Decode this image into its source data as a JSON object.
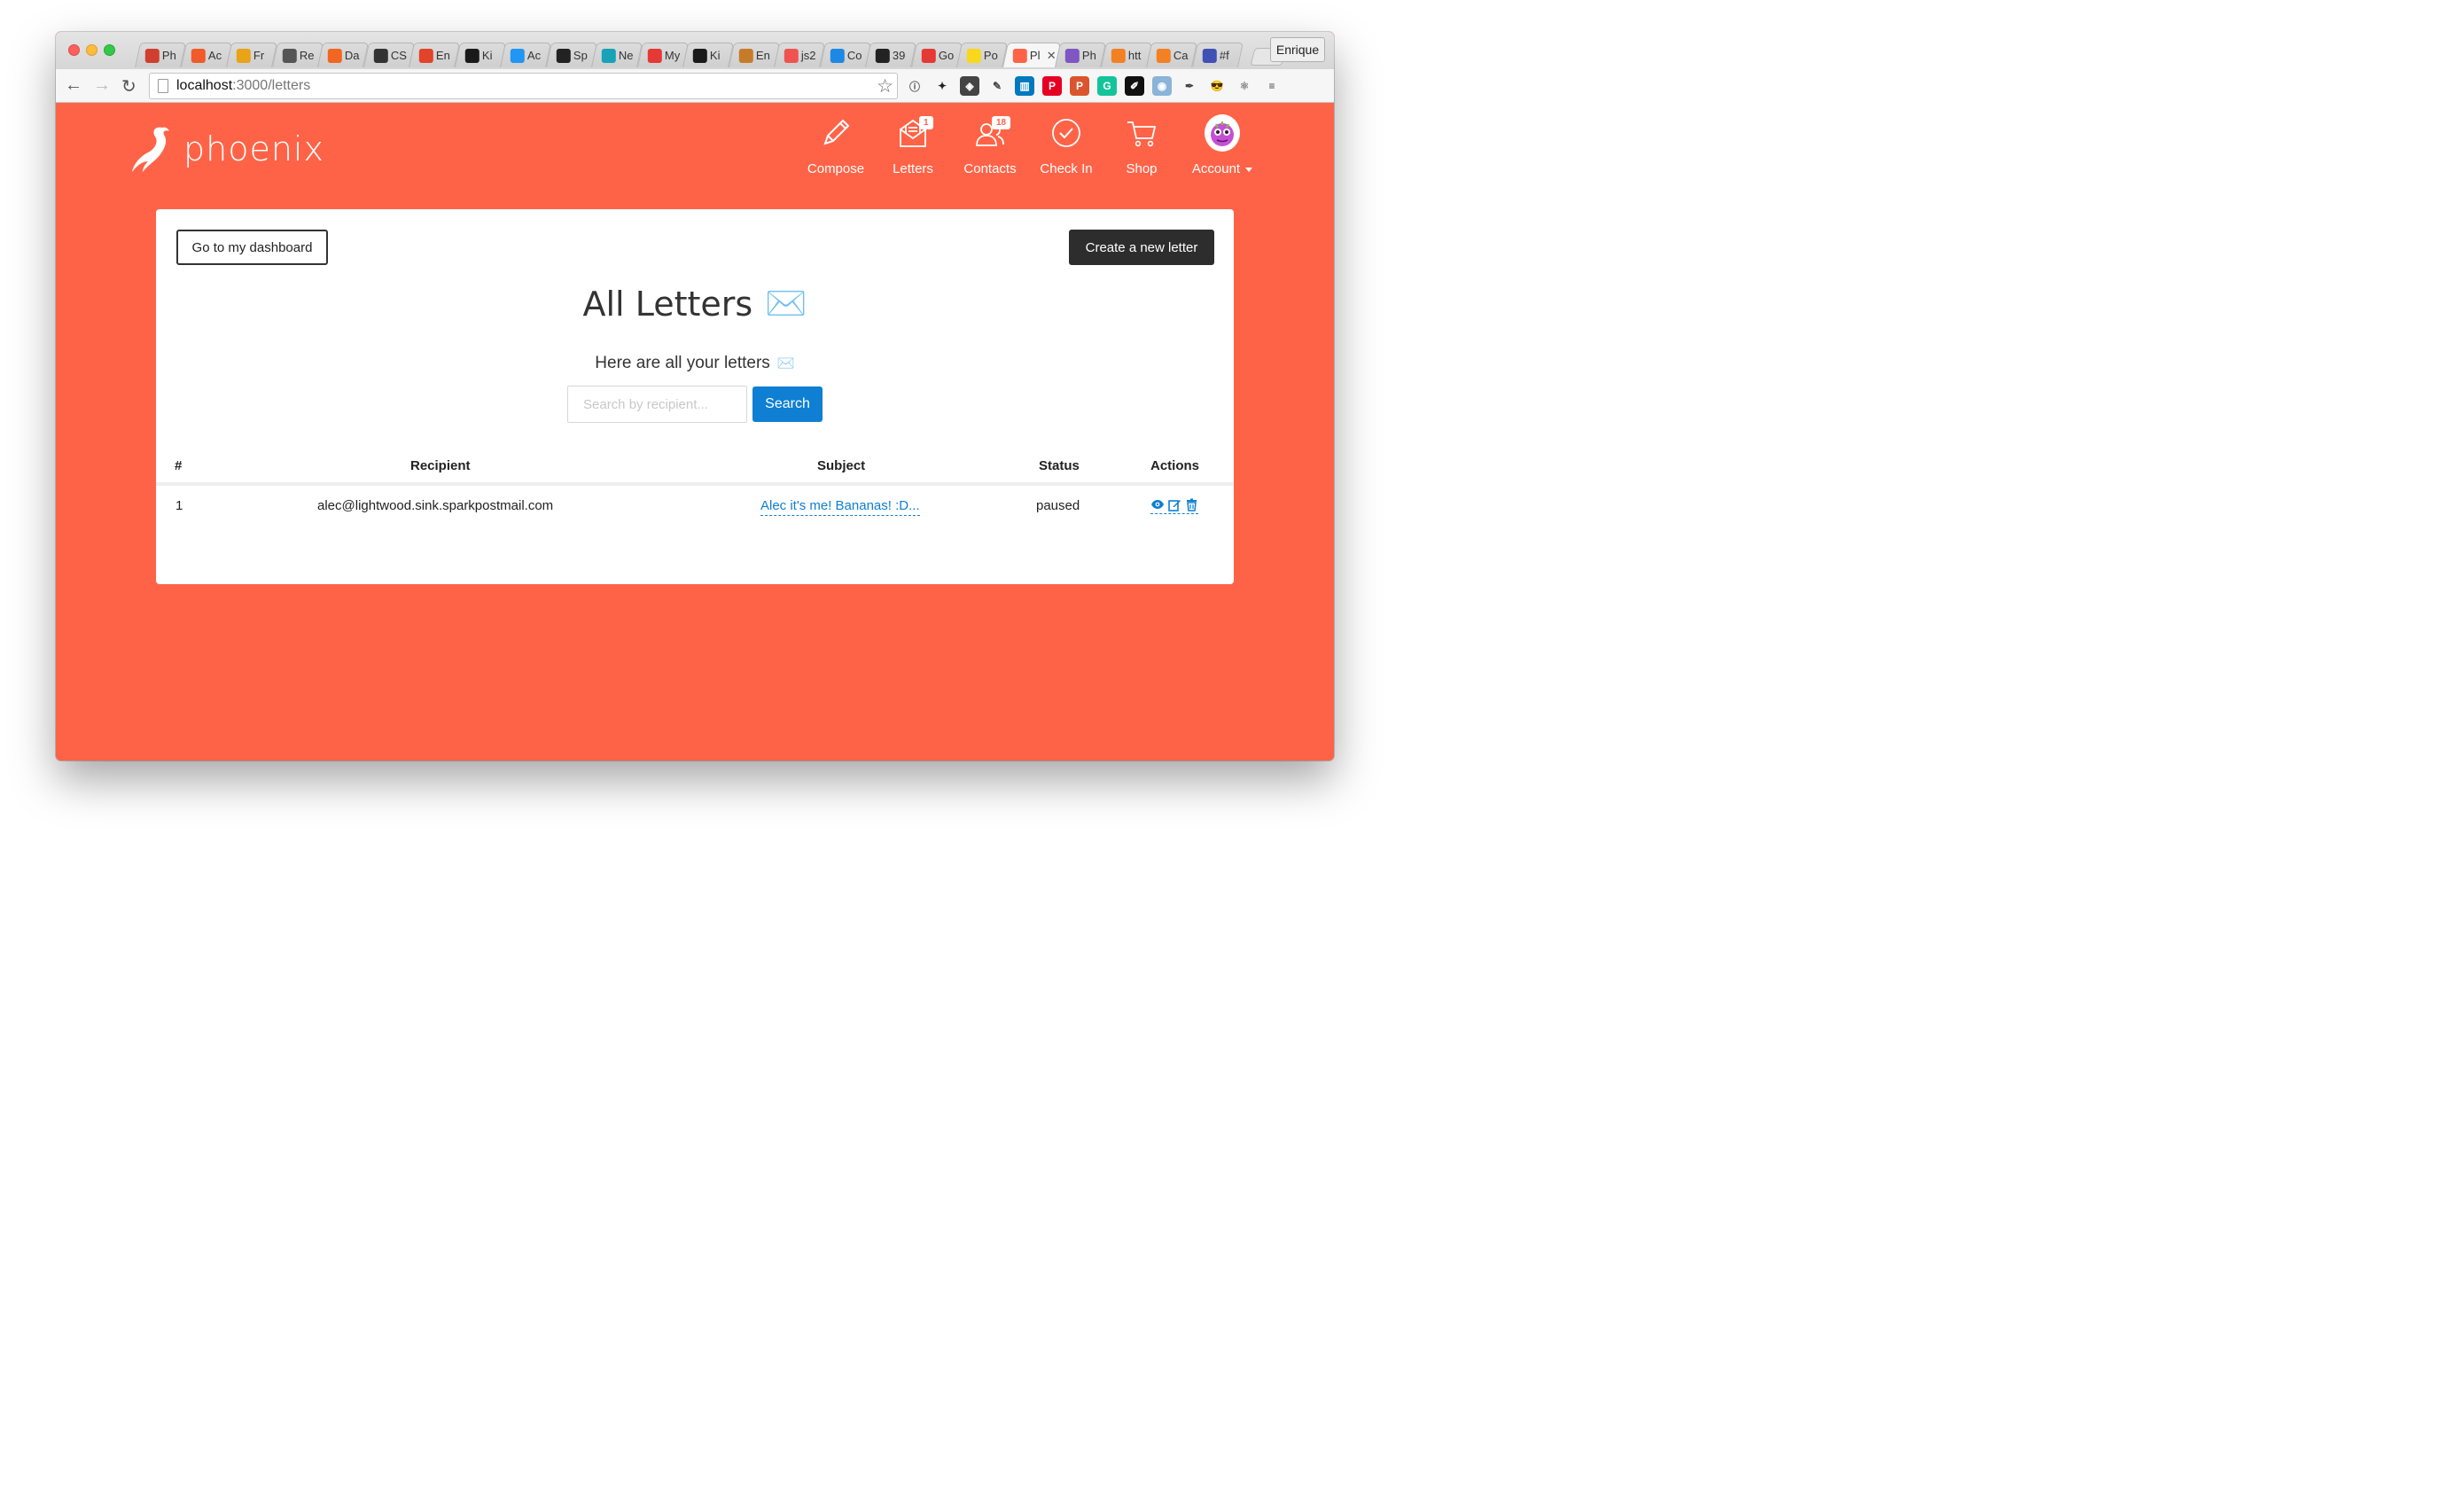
{
  "browser": {
    "tabs": [
      {
        "label": "Ph",
        "icon": "trello-icon",
        "color": "#d03f2e"
      },
      {
        "label": "Ac",
        "icon": "orange-app-icon",
        "color": "#f15a29"
      },
      {
        "label": "Fr",
        "icon": "paper-plane-icon",
        "color": "#e8a317"
      },
      {
        "label": "Re",
        "icon": "magnifier-icon",
        "color": "#555555"
      },
      {
        "label": "Da",
        "icon": "flame-icon",
        "color": "#f26522"
      },
      {
        "label": "CS",
        "icon": "mail-icon",
        "color": "#333333"
      },
      {
        "label": "En",
        "icon": "gitlab-icon",
        "color": "#e24329"
      },
      {
        "label": "Ki",
        "icon": "tk-icon",
        "color": "#1a1a1a"
      },
      {
        "label": "Ac",
        "icon": "diamond-icon",
        "color": "#2196f3"
      },
      {
        "label": "Sp",
        "icon": "github-icon",
        "color": "#222222"
      },
      {
        "label": "Ne",
        "icon": "cycle-icon",
        "color": "#17a2b8"
      },
      {
        "label": "My",
        "icon": "facebook-icon",
        "color": "#e53935"
      },
      {
        "label": "Ki",
        "icon": "tk-icon",
        "color": "#1a1a1a"
      },
      {
        "label": "En",
        "icon": "thumbs-up-icon",
        "color": "#c77b2a"
      },
      {
        "label": "js2",
        "icon": "arrows-icon",
        "color": "#ef5350"
      },
      {
        "label": "Co",
        "icon": "chart-icon",
        "color": "#1e88e5"
      },
      {
        "label": "39",
        "icon": "bold-b-icon",
        "color": "#222222"
      },
      {
        "label": "Go",
        "icon": "triangle-icon",
        "color": "#e53935"
      },
      {
        "label": "Po",
        "icon": "p-icon",
        "color": "#f9d71c"
      },
      {
        "label": "Pl",
        "icon": "phoenix-tab-icon",
        "color": "#ff6347",
        "active": true
      },
      {
        "label": "Ph",
        "icon": "image-icon",
        "color": "#7e57c2"
      },
      {
        "label": "htt",
        "icon": "stack-icon",
        "color": "#f48024"
      },
      {
        "label": "Ca",
        "icon": "stack-icon",
        "color": "#f48024"
      },
      {
        "label": "#f",
        "icon": "hex-icon",
        "color": "#3f51b5"
      }
    ],
    "close_glyph": "✕",
    "profile_name": "Enrique",
    "url_host": "localhost",
    "url_path": ":3000/letters",
    "extensions": [
      {
        "name": "info-icon",
        "glyph": "ⓘ",
        "color": "#555555",
        "bg": "transparent"
      },
      {
        "name": "pin-icon",
        "glyph": "✦",
        "color": "#222222",
        "bg": "transparent"
      },
      {
        "name": "pocket-icon",
        "glyph": "◈",
        "color": "#ffffff",
        "bg": "#444444"
      },
      {
        "name": "evernote-icon",
        "glyph": "✎",
        "color": "#444444",
        "bg": "transparent"
      },
      {
        "name": "trello-icon",
        "glyph": "▥",
        "color": "#ffffff",
        "bg": "#0079bf"
      },
      {
        "name": "pinterest-icon",
        "glyph": "P",
        "color": "#ffffff",
        "bg": "#e60023"
      },
      {
        "name": "producthunt-icon",
        "glyph": "P",
        "color": "#ffffff",
        "bg": "#da552f"
      },
      {
        "name": "grammarly-icon",
        "glyph": "G",
        "color": "#ffffff",
        "bg": "#15c39a"
      },
      {
        "name": "edit-square-icon",
        "glyph": "✐",
        "color": "#ffffff",
        "bg": "#111111"
      },
      {
        "name": "camera-icon",
        "glyph": "◉",
        "color": "#ffffff",
        "bg": "#8ab4d8"
      },
      {
        "name": "eyedropper-icon",
        "glyph": "✒",
        "color": "#444444",
        "bg": "transparent"
      },
      {
        "name": "sunglasses-emoji-icon",
        "glyph": "😎",
        "color": "#222222",
        "bg": "transparent"
      },
      {
        "name": "react-icon",
        "glyph": "⚛",
        "color": "#888888",
        "bg": "transparent"
      },
      {
        "name": "menu-icon",
        "glyph": "≡",
        "color": "#444444",
        "bg": "transparent"
      }
    ]
  },
  "app": {
    "brand": "phoenix",
    "nav": [
      {
        "id": "compose",
        "label": "Compose",
        "badge": ""
      },
      {
        "id": "letters",
        "label": "Letters",
        "badge": "1"
      },
      {
        "id": "contacts",
        "label": "Contacts",
        "badge": "18"
      },
      {
        "id": "checkin",
        "label": "Check In",
        "badge": ""
      },
      {
        "id": "shop",
        "label": "Shop",
        "badge": ""
      },
      {
        "id": "account",
        "label": "Account",
        "badge": ""
      }
    ]
  },
  "page": {
    "dashboard_button": "Go to my dashboard",
    "create_button": "Create a new letter",
    "title": "All Letters",
    "title_emoji": "✉️",
    "subtitle": "Here are all your letters",
    "subtitle_emoji": "✉️",
    "search": {
      "placeholder": "Search by recipient...",
      "value": "",
      "button": "Search"
    },
    "table": {
      "columns": [
        "#",
        "Recipient",
        "Subject",
        "Status",
        "Actions"
      ],
      "rows": [
        {
          "index": "1",
          "recipient": "alec@lightwood.sink.sparkpostmail.com",
          "subject": "Alec it's me! Bananas! :D...",
          "status": "paused"
        }
      ]
    }
  },
  "colors": {
    "brand": "#ff6347",
    "link": "#0e7fd3",
    "dark_button": "#2d2d2d"
  }
}
